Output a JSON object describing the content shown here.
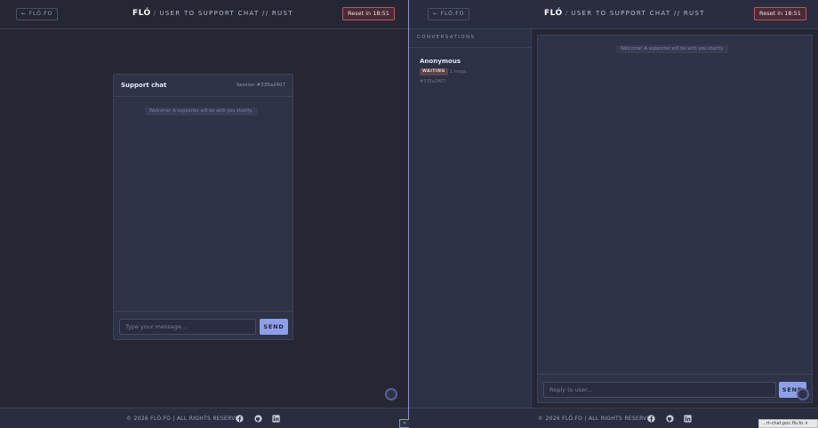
{
  "header": {
    "back_label": "← FLÓ.FO",
    "brand": "FLÓ",
    "slash": "/",
    "subtitle": "USER TO SUPPORT CHAT // RUST",
    "reset_label": "Reset in 18:51"
  },
  "user_chat": {
    "title": "Support chat",
    "session": "Session #335a2407",
    "welcome": "Welcome! A supporter will be with you shortly.",
    "input_placeholder": "Type your message...",
    "send_label": "SEND"
  },
  "support": {
    "sidebar_title": "CONVERSATIONS",
    "conversation": {
      "name": "Anonymous",
      "status": "WAITING",
      "time": "1 msgs",
      "id": "#335a2407"
    },
    "welcome": "Welcome! A supporter will be with you shortly.",
    "reply_placeholder": "Reply to user...",
    "send_label": "SEND"
  },
  "footer": {
    "copyright": "© 2026 FLÓ.FO | ALL RIGHTS RESERVED",
    "icons": [
      "facebook-icon",
      "github-icon",
      "linkedin-icon"
    ]
  },
  "url_chip": "...rt-chat.poc.flo.fo ×",
  "colors": {
    "background": "#262734",
    "panel": "#2f3348",
    "accent": "#8d9fe6",
    "reset_border": "#c0555d",
    "divider": "#8a8fd8"
  }
}
